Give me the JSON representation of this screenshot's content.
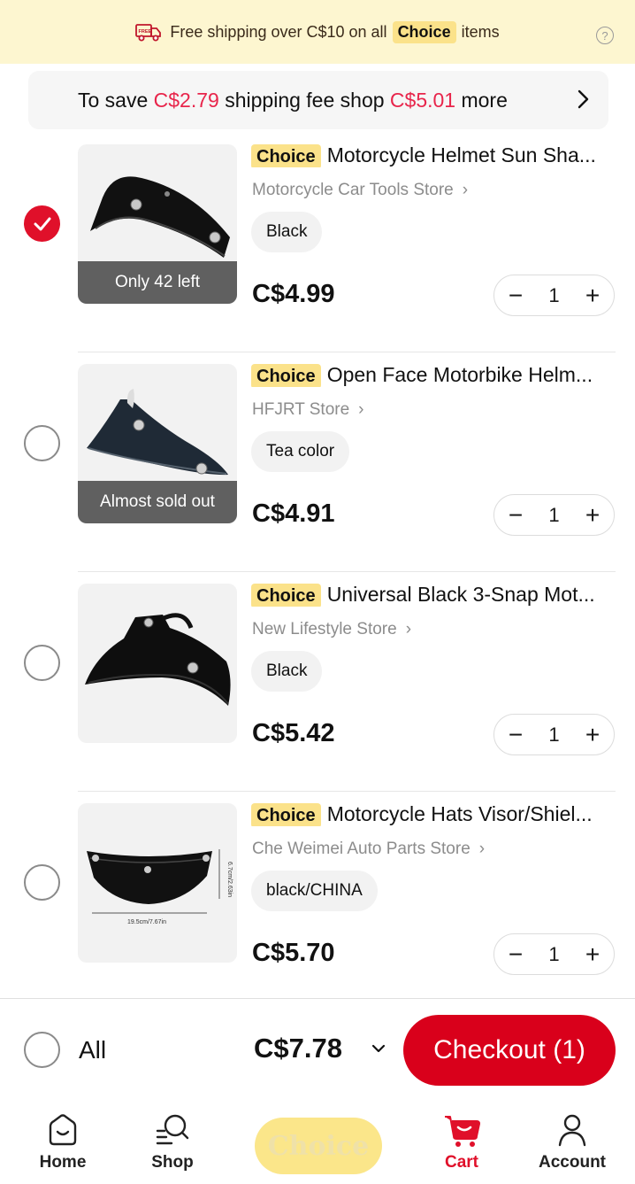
{
  "shipping_banner": {
    "text_before": "Free shipping over C$10 on all",
    "choice_label": "Choice",
    "text_after": "items",
    "help_icon": "?"
  },
  "save_box": {
    "part1": "To save",
    "amount1": "C$2.79",
    "part2": "shipping fee shop",
    "amount2": "C$5.01",
    "part3": "more"
  },
  "items": [
    {
      "selected": true,
      "choice_label": "Choice",
      "title": "Motorcycle Helmet Sun Sha...",
      "store": "Motorcycle Car Tools Store",
      "variant": "Black",
      "price": "C$4.99",
      "quantity": "1",
      "stock_badge": "Only 42 left"
    },
    {
      "selected": false,
      "choice_label": "Choice",
      "title": "Open Face Motorbike Helm...",
      "store": "HFJRT Store",
      "variant": "Tea color",
      "price": "C$4.91",
      "quantity": "1",
      "stock_badge": "Almost sold out"
    },
    {
      "selected": false,
      "choice_label": "Choice",
      "title": "Universal Black 3-Snap Mot...",
      "store": "New Lifestyle Store",
      "variant": "Black",
      "price": "C$5.42",
      "quantity": "1",
      "stock_badge": ""
    },
    {
      "selected": false,
      "choice_label": "Choice",
      "title": "Motorcycle Hats Visor/Shiel...",
      "store": "Che Weimei Auto Parts Store",
      "variant": "black/CHINA",
      "price": "C$5.70",
      "quantity": "1",
      "stock_badge": "",
      "dimension_labels": [
        "6.7cm/2.63in",
        "19.5cm/7.67in"
      ]
    }
  ],
  "summary": {
    "all_label": "All",
    "total": "C$7.78",
    "checkout_label": "Checkout",
    "checkout_count": "(1)"
  },
  "tabbar": {
    "home": "Home",
    "shop": "Shop",
    "choice": "Choice",
    "cart": "Cart",
    "account": "Account",
    "active": "cart"
  },
  "colors": {
    "accent_red": "#e0102a",
    "price_red": "#e8254b",
    "choice_yellow": "#fbe28a",
    "banner_bg": "#fdf6d0"
  }
}
